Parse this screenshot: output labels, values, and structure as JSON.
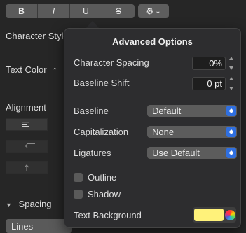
{
  "toolbar": {
    "bold": "B",
    "italic": "I",
    "underline": "U",
    "strike": "S",
    "gear": "⚙",
    "gear_caret": "⌄"
  },
  "inspector": {
    "character_styles": "Character Style",
    "text_color": "Text Color",
    "text_color_arrow": "⌃",
    "alignment": "Alignment",
    "spacing": "Spacing",
    "spacing_triangle": "▼",
    "lines": "Lines"
  },
  "popover": {
    "title": "Advanced Options",
    "character_spacing": {
      "label": "Character Spacing",
      "value": "0%"
    },
    "baseline_shift": {
      "label": "Baseline Shift",
      "value": "0 pt"
    },
    "baseline": {
      "label": "Baseline",
      "value": "Default"
    },
    "capitalization": {
      "label": "Capitalization",
      "value": "None"
    },
    "ligatures": {
      "label": "Ligatures",
      "value": "Use Default"
    },
    "outline": "Outline",
    "shadow": "Shadow",
    "text_background": {
      "label": "Text Background",
      "color": "#fff27a"
    }
  }
}
